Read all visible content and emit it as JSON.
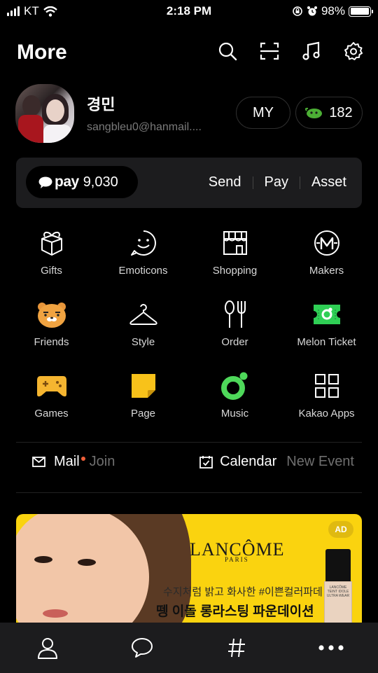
{
  "status_bar": {
    "carrier": "KT",
    "time": "2:18 PM",
    "battery": "98%",
    "battery_level": 0.98
  },
  "header": {
    "title": "More",
    "icons": [
      "search-icon",
      "scan-icon",
      "music-note-icon",
      "settings-icon"
    ]
  },
  "profile": {
    "name": "경민",
    "email": "sangbleu0@hanmail....",
    "my_label": "MY",
    "coin_count": "182"
  },
  "pay": {
    "logo_text": "pay",
    "balance": "9,030",
    "actions": [
      "Send",
      "Pay",
      "Asset"
    ]
  },
  "services": [
    {
      "label": "Gifts",
      "icon": "gift-icon"
    },
    {
      "label": "Emoticons",
      "icon": "smiley-icon"
    },
    {
      "label": "Shopping",
      "icon": "storefront-icon"
    },
    {
      "label": "Makers",
      "icon": "makers-m-icon"
    },
    {
      "label": "Friends",
      "icon": "ryan-bear-icon"
    },
    {
      "label": "Style",
      "icon": "hanger-icon"
    },
    {
      "label": "Order",
      "icon": "fork-spoon-icon"
    },
    {
      "label": "Melon Ticket",
      "icon": "ticket-icon"
    },
    {
      "label": "Games",
      "icon": "gamepad-icon"
    },
    {
      "label": "Page",
      "icon": "sticky-note-icon"
    },
    {
      "label": "Music",
      "icon": "melon-icon"
    },
    {
      "label": "Kakao Apps",
      "icon": "apps-grid-icon"
    }
  ],
  "mail": {
    "label": "Mail",
    "secondary": "Join"
  },
  "calendar": {
    "label": "Calendar",
    "secondary": "New Event"
  },
  "ad": {
    "badge": "AD",
    "brand": "LANCÔME",
    "brand_sub": "PARIS",
    "line1": "수지처럼 밝고 화사한 #이쁜컬러파데",
    "line2": "뗑 이돌 롱라스팅 파운데이션",
    "bottle_text": "LANCÔME\nTEINT IDOLE ULTRA WEAR"
  },
  "tabbar": {
    "tabs": [
      "person-icon",
      "chat-bubble-icon",
      "hashtag-icon",
      "more-dots-icon"
    ]
  },
  "colors": {
    "background": "#000000",
    "card": "#1c1c1e",
    "kakao_yellow": "#fad30f",
    "melon_green": "#4ed85a",
    "notification": "#f0603a"
  }
}
